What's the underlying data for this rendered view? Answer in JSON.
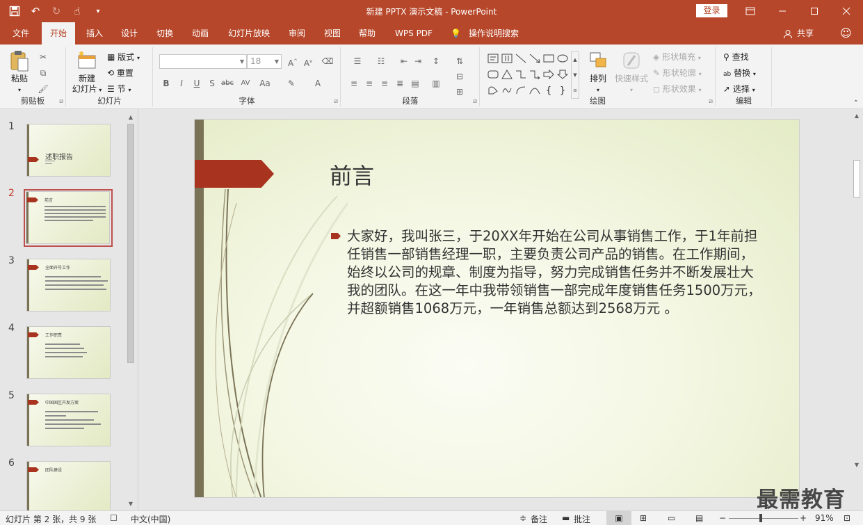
{
  "window": {
    "title": "新建 PPTX 演示文稿 - PowerPoint",
    "login_label": "登录"
  },
  "tabs": [
    {
      "label": "文件"
    },
    {
      "label": "开始"
    },
    {
      "label": "插入"
    },
    {
      "label": "设计"
    },
    {
      "label": "切换"
    },
    {
      "label": "动画"
    },
    {
      "label": "幻灯片放映"
    },
    {
      "label": "审阅"
    },
    {
      "label": "视图"
    },
    {
      "label": "帮助"
    },
    {
      "label": "WPS PDF"
    },
    {
      "label": "操作说明搜索"
    }
  ],
  "share_label": "共享",
  "ribbon": {
    "clipboard": {
      "paste": "粘贴",
      "label": "剪贴板"
    },
    "slides": {
      "new_slide_line1": "新建",
      "new_slide_line2": "幻灯片",
      "layout": "版式",
      "reset": "重置",
      "section": "节",
      "label": "幻灯片"
    },
    "font": {
      "font_size": "18",
      "label": "字体"
    },
    "paragraph": {
      "label": "段落"
    },
    "drawing": {
      "arrange": "排列",
      "quick_styles": "快速样式",
      "shape_fill": "形状填充",
      "shape_outline": "形状轮廓",
      "shape_effects": "形状效果",
      "label": "绘图"
    },
    "editing": {
      "find": "查找",
      "replace": "替换",
      "select": "选择",
      "label": "编辑"
    }
  },
  "thumbnails": [
    {
      "num": "1",
      "title": "述职报告"
    },
    {
      "num": "2",
      "title": "前言"
    },
    {
      "num": "3",
      "title": "全面开号工作"
    },
    {
      "num": "4",
      "title": "工作职责"
    },
    {
      "num": "5",
      "title": "中国国区开发方案"
    },
    {
      "num": "6",
      "title": "团队建设"
    }
  ],
  "slide": {
    "title": "前言",
    "body": "大家好，我叫张三，于20XX年开始在公司从事销售工作，于1年前担任销售一部销售经理一职，主要负责公司产品的销售。在工作期间，始终以公司的规章、制度为指导，努力完成销售任务并不断发展壮大我的团队。在这一年中我带领销售一部完成年度销售任务1500万元，并超额销售1068万元，一年销售总额达到2568万元 。"
  },
  "status": {
    "slide_info": "幻灯片 第 2 张，共 9 张",
    "language": "中文(中国)",
    "notes": "备注",
    "comments": "批注",
    "zoom": "91%"
  },
  "watermark": "最需教育",
  "colors": {
    "brand": "#b7472a",
    "slide_accent": "#a8331f",
    "slide_bar": "#7a7256"
  }
}
